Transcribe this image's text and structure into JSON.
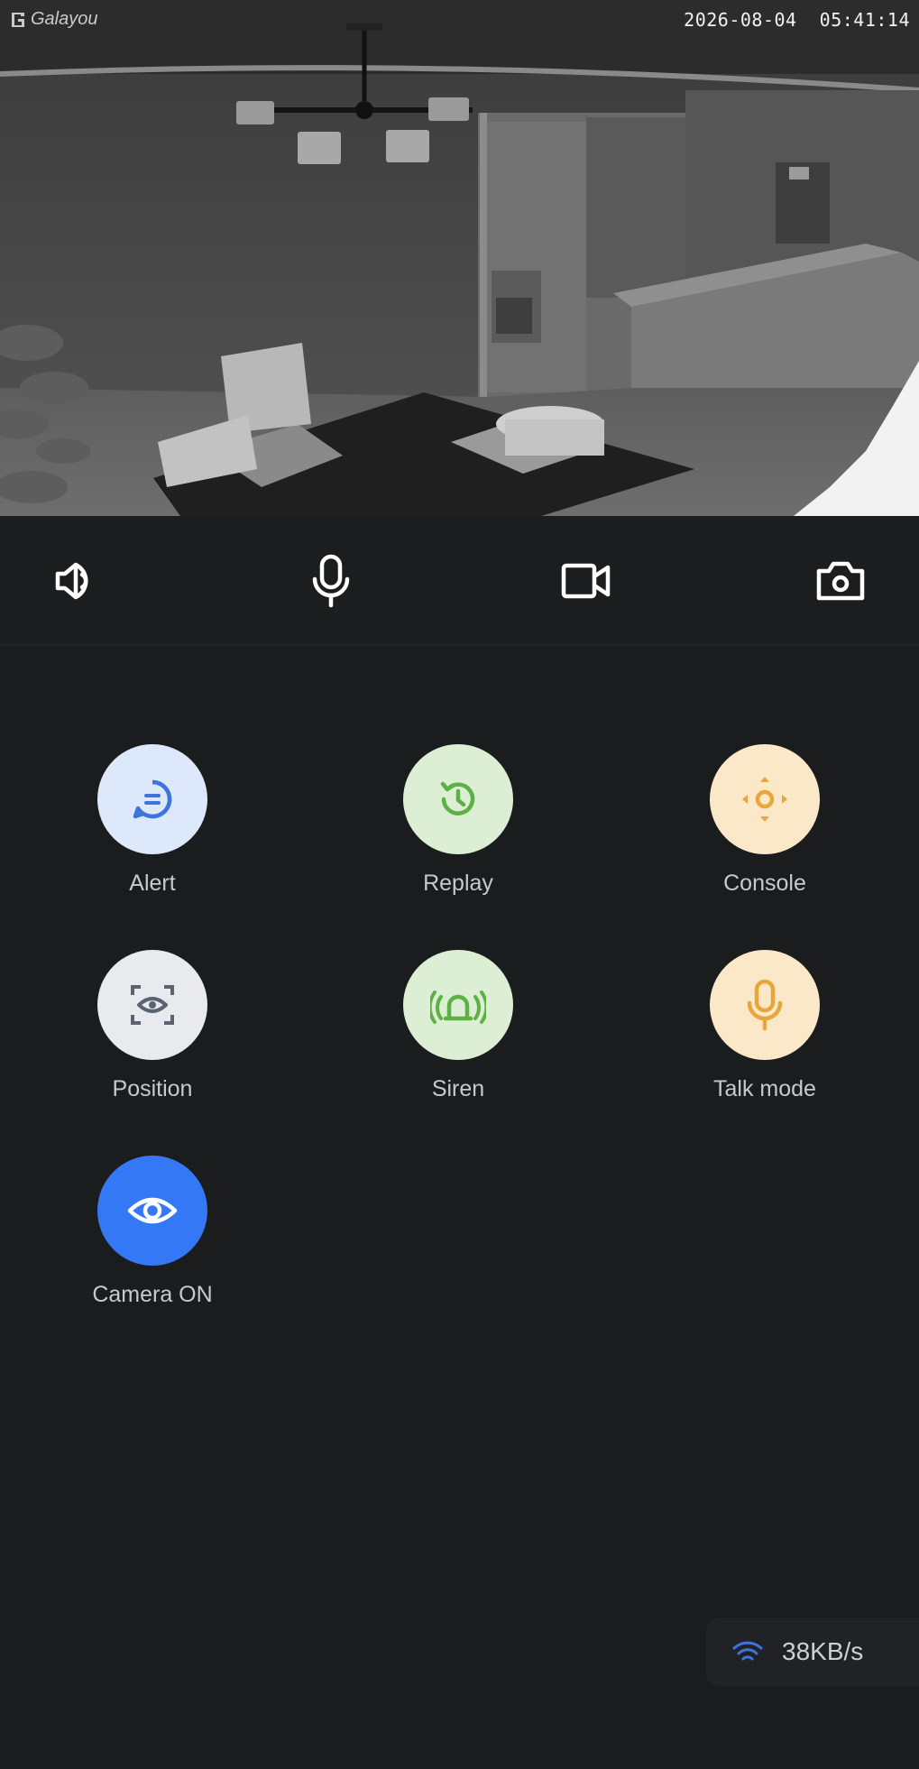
{
  "feed": {
    "brand": "Galayou",
    "timestamp": "2026-08-04  05:41:14"
  },
  "toolbar": {
    "items": [
      {
        "name": "speaker-icon"
      },
      {
        "name": "microphone-icon"
      },
      {
        "name": "record-video-icon"
      },
      {
        "name": "snapshot-camera-icon"
      }
    ]
  },
  "features": [
    {
      "label": "Alert",
      "icon": "message-icon",
      "bg": "#dde8fb",
      "fg": "#3c74e0"
    },
    {
      "label": "Replay",
      "icon": "history-icon",
      "bg": "#dcefd4",
      "fg": "#5cb044"
    },
    {
      "label": "Console",
      "icon": "dpad-icon",
      "bg": "#fbe8c8",
      "fg": "#e8a63c"
    },
    {
      "label": "Position",
      "icon": "focus-eye-icon",
      "bg": "#e8eaed",
      "fg": "#5a6470"
    },
    {
      "label": "Siren",
      "icon": "siren-icon",
      "bg": "#dcefd4",
      "fg": "#5cb044"
    },
    {
      "label": "Talk mode",
      "icon": "microphone-icon",
      "bg": "#fbe8c8",
      "fg": "#e8a63c"
    },
    {
      "label": "Camera ON",
      "icon": "eye-icon",
      "bg": "#3478f6",
      "fg": "#ffffff"
    }
  ],
  "network": {
    "speed": "38KB/s",
    "icon": "wifi-icon",
    "icon_color": "#3c74e0"
  }
}
